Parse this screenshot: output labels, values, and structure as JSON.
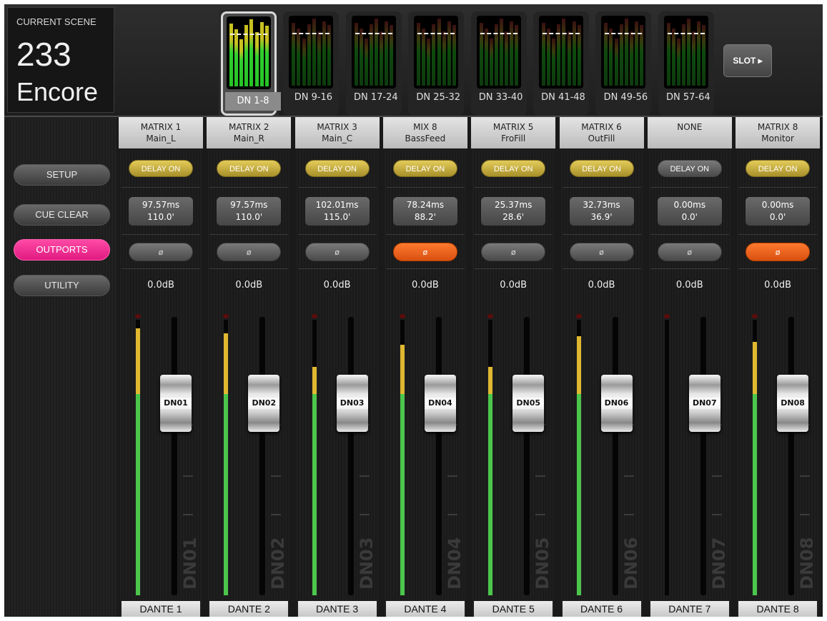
{
  "scene": {
    "label": "CURRENT SCENE",
    "number": "233",
    "name": "Encore"
  },
  "banks": [
    {
      "label": "DN 1-8",
      "selected": true
    },
    {
      "label": "DN 9-16",
      "selected": false
    },
    {
      "label": "DN 17-24",
      "selected": false
    },
    {
      "label": "DN 25-32",
      "selected": false
    },
    {
      "label": "DN 33-40",
      "selected": false
    },
    {
      "label": "DN 41-48",
      "selected": false
    },
    {
      "label": "DN 49-56",
      "selected": false
    },
    {
      "label": "DN 57-64",
      "selected": false
    }
  ],
  "slot_label": "SLOT ▸",
  "nav": {
    "setup": "SETUP",
    "cue_clear": "CUE CLEAR",
    "outports": "OUTPORTS",
    "utility": "UTILITY"
  },
  "colors": {
    "accent_pink": "#e8268a",
    "delay_on": "#c8b040",
    "phase_on": "#e86018",
    "meter_green": "#4cc64c",
    "meter_yellow": "#e0b830"
  },
  "phase_symbol": "ø",
  "strips": [
    {
      "source": "MATRIX 1",
      "name": "Main_L",
      "delay_label": "DELAY ON",
      "delay_on": true,
      "delay_ms": "97.57ms",
      "delay_ft": "110.0'",
      "phase_on": false,
      "level": "0.0dB",
      "fader_label": "DN01",
      "port": "DANTE 1",
      "meter_level": 0.97,
      "fader_level": 0.74
    },
    {
      "source": "MATRIX 2",
      "name": "Main_R",
      "delay_label": "DELAY ON",
      "delay_on": true,
      "delay_ms": "97.57ms",
      "delay_ft": "110.0'",
      "phase_on": false,
      "level": "0.0dB",
      "fader_label": "DN02",
      "port": "DANTE 2",
      "meter_level": 0.95,
      "fader_level": 0.74
    },
    {
      "source": "MATRIX 3",
      "name": "Main_C",
      "delay_label": "DELAY ON",
      "delay_on": true,
      "delay_ms": "102.01ms",
      "delay_ft": "115.0'",
      "phase_on": false,
      "level": "0.0dB",
      "fader_label": "DN03",
      "port": "DANTE 3",
      "meter_level": 0.83,
      "fader_level": 0.74
    },
    {
      "source": "MIX 8",
      "name": "BassFeed",
      "delay_label": "DELAY ON",
      "delay_on": true,
      "delay_ms": "78.24ms",
      "delay_ft": "88.2'",
      "phase_on": true,
      "level": "0.0dB",
      "fader_label": "DN04",
      "port": "DANTE 4",
      "meter_level": 0.91,
      "fader_level": 0.74
    },
    {
      "source": "MATRIX 5",
      "name": "FroFill",
      "delay_label": "DELAY ON",
      "delay_on": true,
      "delay_ms": "25.37ms",
      "delay_ft": "28.6'",
      "phase_on": false,
      "level": "0.0dB",
      "fader_label": "DN05",
      "port": "DANTE 5",
      "meter_level": 0.83,
      "fader_level": 0.74
    },
    {
      "source": "MATRIX 6",
      "name": "OutFill",
      "delay_label": "DELAY ON",
      "delay_on": true,
      "delay_ms": "32.73ms",
      "delay_ft": "36.9'",
      "phase_on": false,
      "level": "0.0dB",
      "fader_label": "DN06",
      "port": "DANTE 6",
      "meter_level": 0.94,
      "fader_level": 0.74
    },
    {
      "source": "NONE",
      "name": "",
      "delay_label": "DELAY ON",
      "delay_on": false,
      "delay_ms": "0.00ms",
      "delay_ft": "0.0'",
      "phase_on": false,
      "level": "0.0dB",
      "fader_label": "DN07",
      "port": "DANTE 7",
      "meter_level": 0.0,
      "fader_level": 0.74
    },
    {
      "source": "MATRIX 8",
      "name": "Monitor",
      "delay_label": "DELAY ON",
      "delay_on": true,
      "delay_ms": "0.00ms",
      "delay_ft": "0.0'",
      "phase_on": true,
      "level": "0.0dB",
      "fader_label": "DN08",
      "port": "DANTE 8",
      "meter_level": 0.92,
      "fader_level": 0.74
    }
  ]
}
